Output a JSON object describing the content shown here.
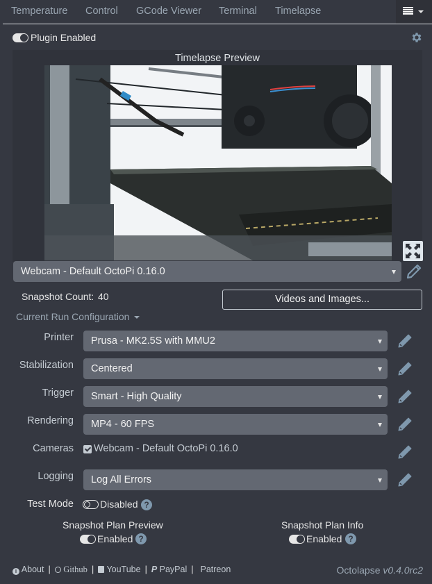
{
  "tabs": [
    {
      "label": "Temperature"
    },
    {
      "label": "Control"
    },
    {
      "label": "GCode Viewer"
    },
    {
      "label": "Terminal"
    },
    {
      "label": "Timelapse"
    }
  ],
  "menu": {
    "icon": "hamburger-menu-icon"
  },
  "plugin": {
    "toggle_state": "on",
    "label": "Plugin Enabled"
  },
  "preview": {
    "title": "Timelapse Preview",
    "image_description": "Webcam view of Prusa 3D printer extruder and print bed"
  },
  "camera_select": {
    "value": "Webcam - Default OctoPi 0.16.0"
  },
  "snapshot": {
    "label": "Snapshot Count:",
    "value": "40"
  },
  "videos_button": {
    "label": "Videos and Images..."
  },
  "run_config": {
    "label": "Current Run Configuration"
  },
  "config_rows": [
    {
      "label": "Printer",
      "value": "Prusa - MK2.5S with MMU2"
    },
    {
      "label": "Stabilization",
      "value": "Centered"
    },
    {
      "label": "Trigger",
      "value": "Smart - High Quality"
    },
    {
      "label": "Rendering",
      "value": "MP4 - 60 FPS"
    },
    {
      "label": "Cameras",
      "value": "Webcam - Default OctoPi 0.16.0",
      "checked": true
    },
    {
      "label": "Logging",
      "value": "Log All Errors"
    }
  ],
  "test_mode": {
    "label": "Test Mode",
    "state_label": "Disabled",
    "toggle_state": "off"
  },
  "snapshot_plan_preview": {
    "title": "Snapshot Plan Preview",
    "state_label": "Enabled",
    "toggle_state": "on"
  },
  "snapshot_plan_info": {
    "title": "Snapshot Plan Info",
    "state_label": "Enabled",
    "toggle_state": "on"
  },
  "footer": {
    "links": [
      {
        "label": "About",
        "icon": "info-icon"
      },
      {
        "label": "Github",
        "icon": "github-icon"
      },
      {
        "label": "YouTube",
        "icon": "youtube-icon"
      },
      {
        "label": "PayPal",
        "icon": "paypal-icon"
      },
      {
        "label": "Patreon",
        "icon": ""
      }
    ],
    "app_name": "Octolapse",
    "version": "v0.4.0rc2"
  },
  "colors": {
    "background": "#353841",
    "select_bg": "#636872",
    "icon_blue": "#7f98ad"
  }
}
